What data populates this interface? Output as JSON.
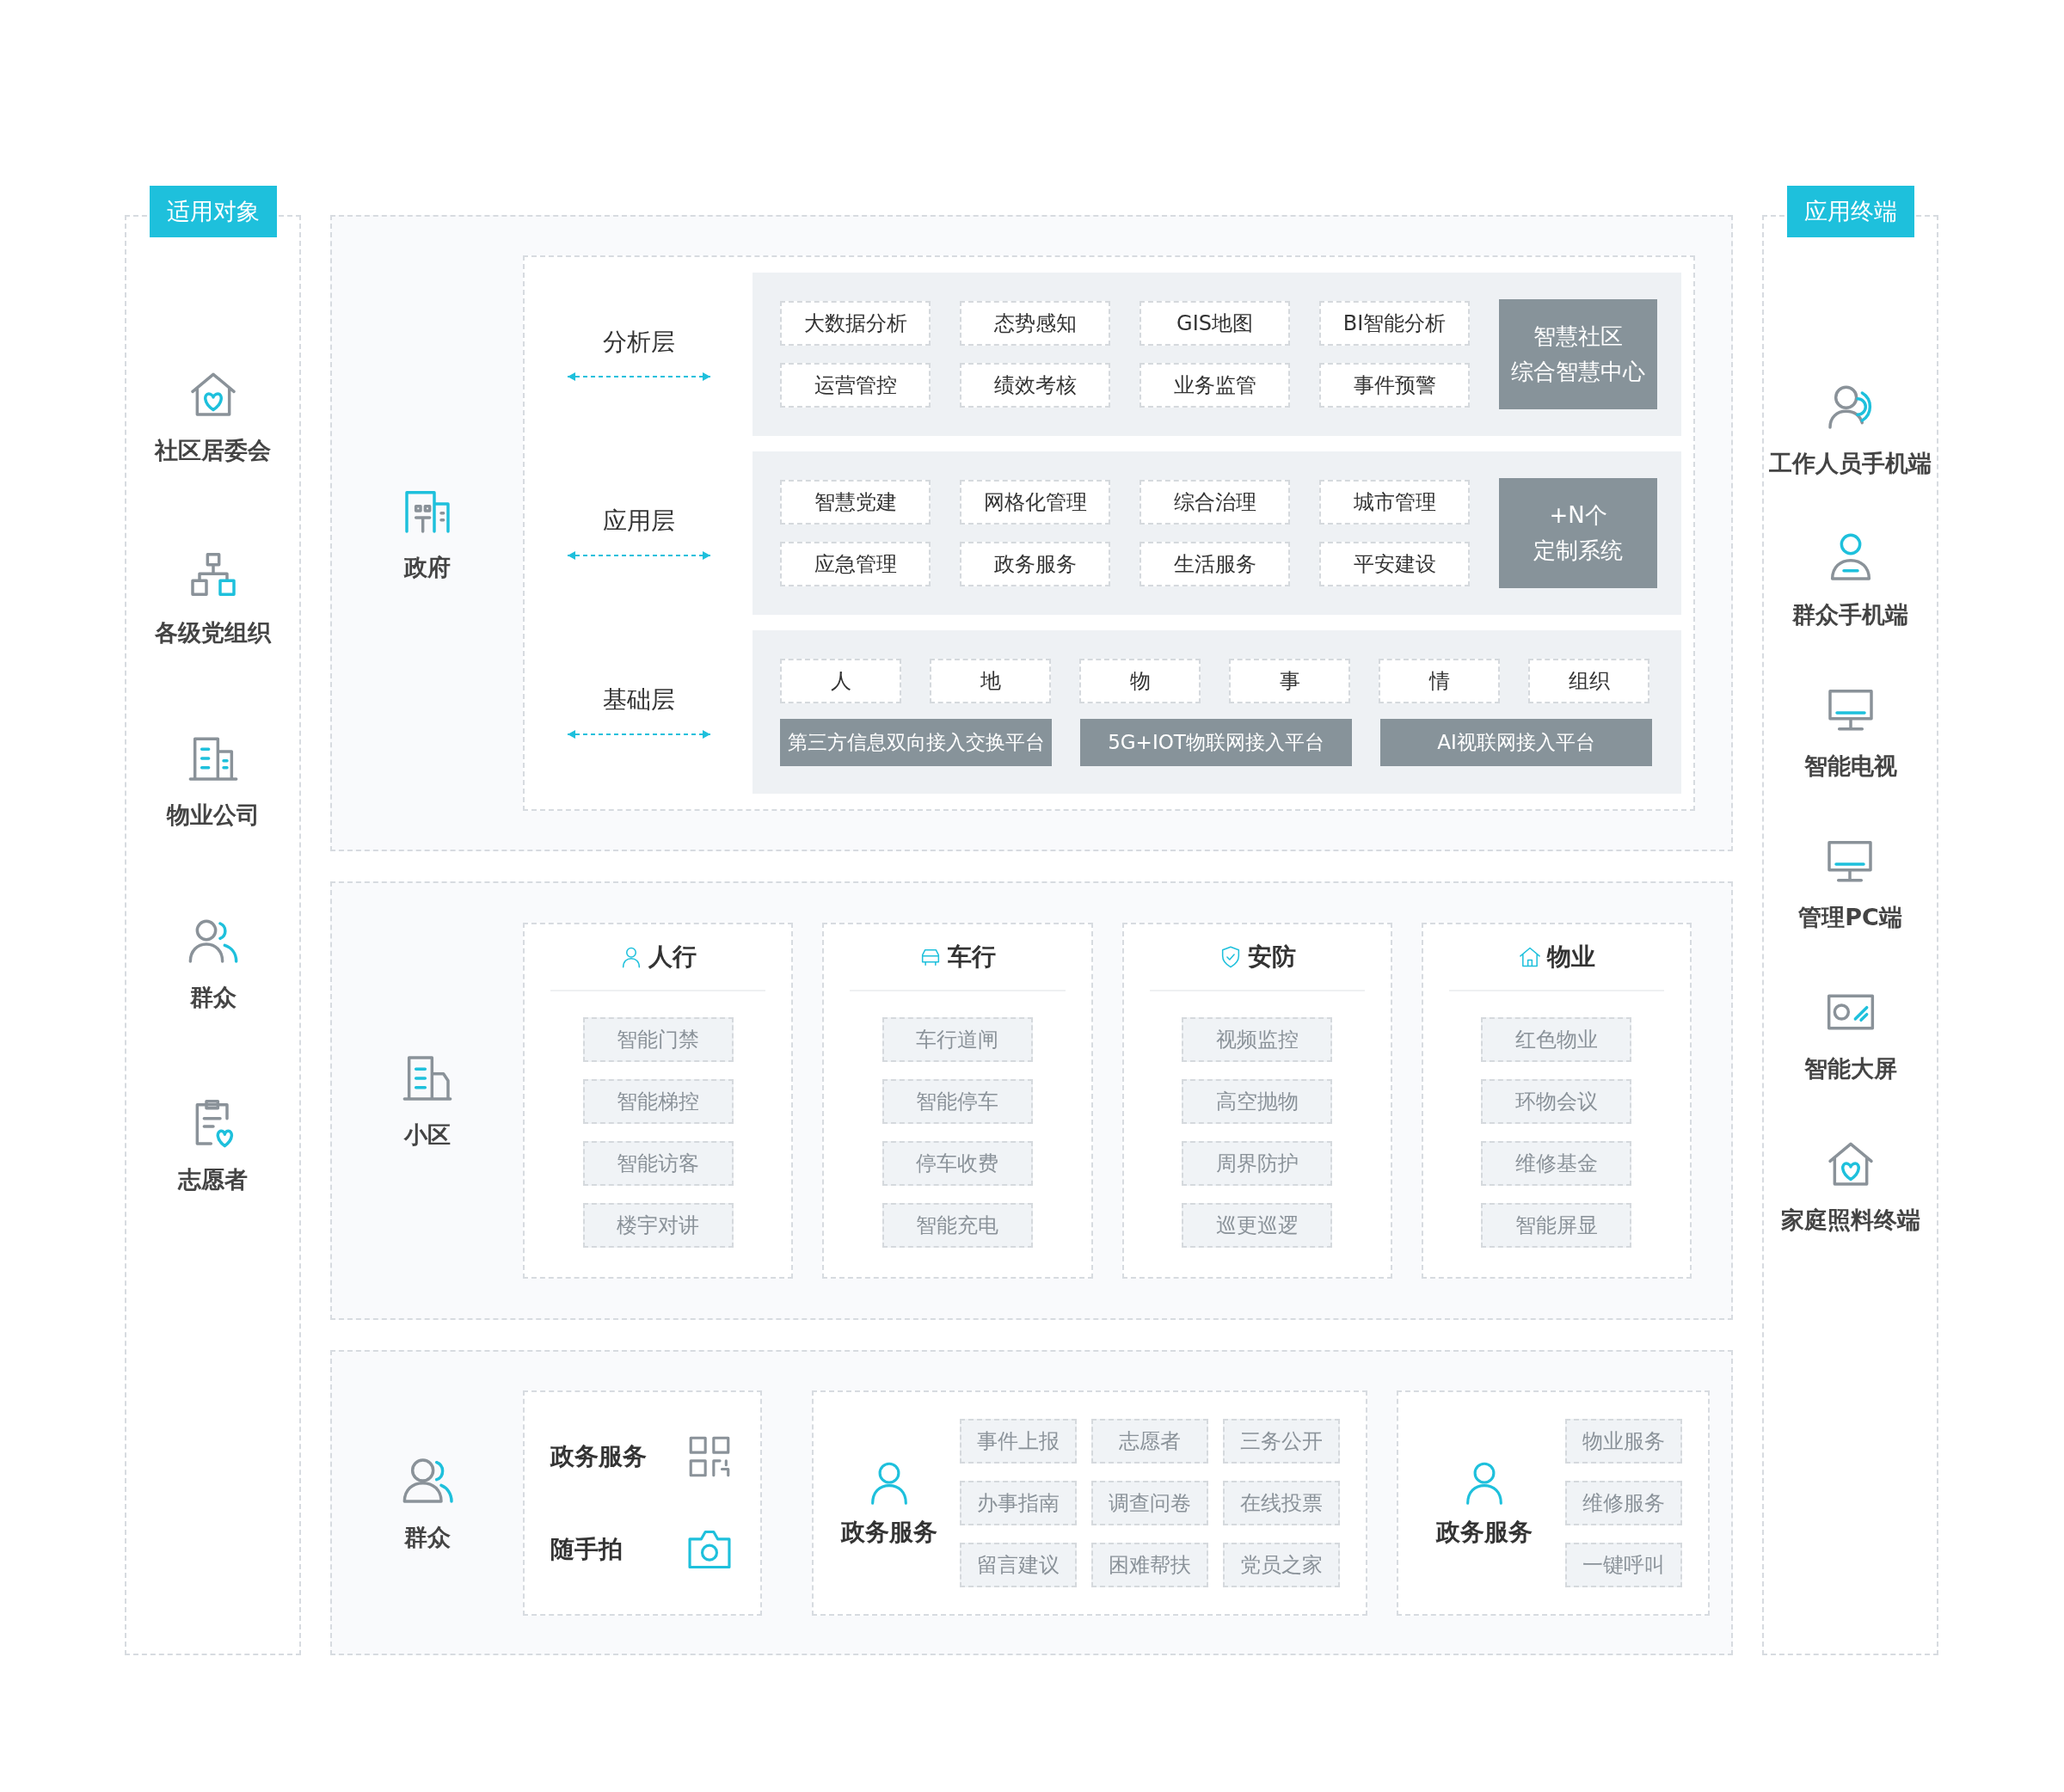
{
  "target_users": {
    "badge": "适用对象",
    "items": [
      "社区居委会",
      "各级党组织",
      "物业公司",
      "群众",
      "志愿者"
    ]
  },
  "government": {
    "label": "政府",
    "layers": [
      {
        "kind": "grid",
        "name": "分析层",
        "items": [
          "大数据分析",
          "态势感知",
          "GIS地图",
          "BI智能分析",
          "运营管控",
          "绩效考核",
          "业务监管",
          "事件预警"
        ],
        "center": [
          "智慧社区",
          "综合智慧中心"
        ]
      },
      {
        "kind": "grid",
        "name": "应用层",
        "items": [
          "智慧党建",
          "网格化管理",
          "综合治理",
          "城市管理",
          "应急管理",
          "政务服务",
          "生活服务",
          "平安建设"
        ],
        "center": [
          "+N个",
          "定制系统"
        ]
      },
      {
        "kind": "base",
        "name": "基础层",
        "items": [
          "人",
          "地",
          "物",
          "事",
          "情",
          "组织"
        ],
        "platforms": [
          "第三方信息双向接入交换平台",
          "5G+IOT物联网接入平台",
          "AI视联网接入平台"
        ]
      }
    ]
  },
  "community": {
    "label": "小区",
    "categories": [
      {
        "title": "人行",
        "items": [
          "智能门禁",
          "智能梯控",
          "智能访客",
          "楼宇对讲"
        ]
      },
      {
        "title": "车行",
        "items": [
          "车行道闸",
          "智能停车",
          "停车收费",
          "智能充电"
        ]
      },
      {
        "title": "安防",
        "items": [
          "视频监控",
          "高空抛物",
          "周界防护",
          "巡更巡逻"
        ]
      },
      {
        "title": "物业",
        "items": [
          "红色物业",
          "环物会议",
          "维修基金",
          "智能屏显"
        ]
      }
    ]
  },
  "residents": {
    "label": "群众",
    "entries": [
      "政务服务",
      "随手拍"
    ],
    "services": [
      {
        "title": "政务服务",
        "items": [
          "事件上报",
          "志愿者",
          "三务公开",
          "办事指南",
          "调查问卷",
          "在线投票",
          "留言建议",
          "困难帮扶",
          "党员之家"
        ]
      },
      {
        "title": "政务服务",
        "items": [
          "物业服务",
          "维修服务",
          "一键呼叫"
        ]
      }
    ]
  },
  "terminals": {
    "badge": "应用终端",
    "items": [
      "工作人员手机端",
      "群众手机端",
      "智能电视",
      "管理PC端",
      "智能大屏",
      "家庭照料终端"
    ]
  }
}
